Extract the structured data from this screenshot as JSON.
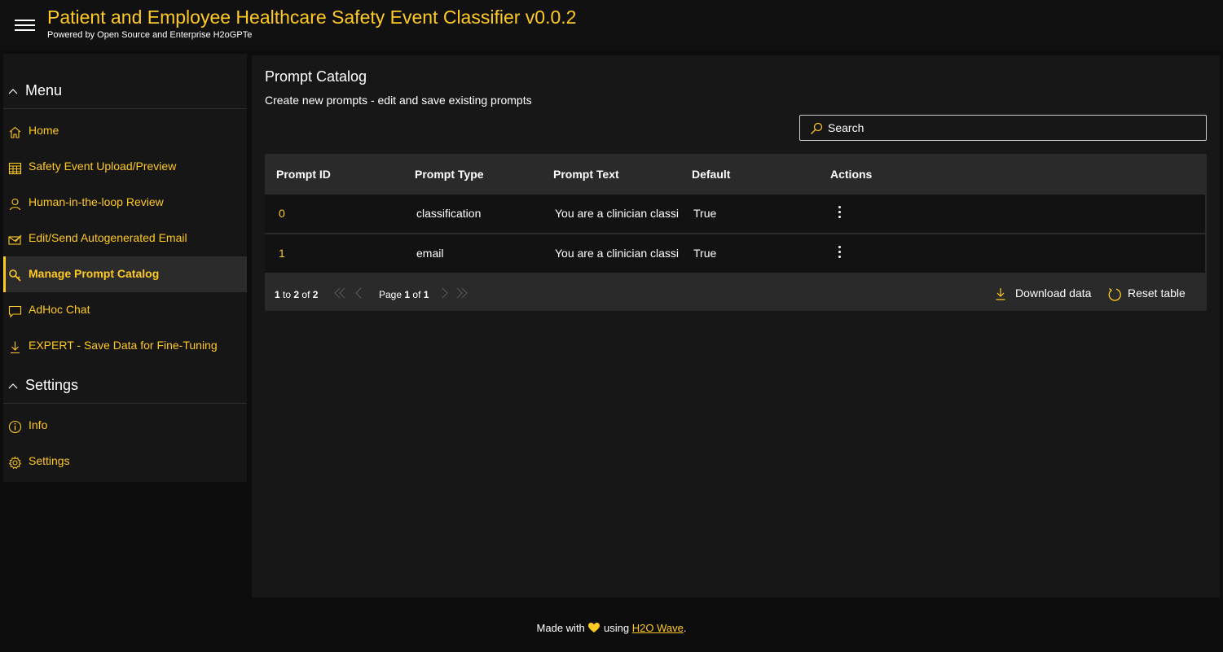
{
  "header": {
    "title": "Patient and Employee Healthcare Safety Event Classifier v0.0.2",
    "subtitle": "Powered by Open Source and Enterprise H2oGPTe"
  },
  "sidebar": {
    "menu_section": "Menu",
    "settings_section": "Settings",
    "items": [
      {
        "label": "Home",
        "icon": "home-icon"
      },
      {
        "label": "Safety Event Upload/Preview",
        "icon": "table-icon"
      },
      {
        "label": "Human-in-the-loop Review",
        "icon": "person-icon"
      },
      {
        "label": "Edit/Send Autogenerated Email",
        "icon": "email-edit-icon"
      },
      {
        "label": "Manage Prompt Catalog",
        "icon": "search-key-icon",
        "active": true
      },
      {
        "label": "AdHoc Chat",
        "icon": "chat-icon"
      },
      {
        "label": "EXPERT - Save Data for Fine-Tuning",
        "icon": "download-icon"
      }
    ],
    "settings_items": [
      {
        "label": "Info",
        "icon": "info-icon"
      },
      {
        "label": "Settings",
        "icon": "gear-icon"
      }
    ]
  },
  "main": {
    "title": "Prompt Catalog",
    "subtitle": "Create new prompts - edit and save existing prompts",
    "search": {
      "placeholder": "Search",
      "value": ""
    },
    "table": {
      "columns": [
        "Prompt ID",
        "Prompt Type",
        "Prompt Text",
        "Default",
        "Actions"
      ],
      "rows": [
        {
          "id": "0",
          "type": "classification",
          "text": "You are a clinician classi",
          "default": "True"
        },
        {
          "id": "1",
          "type": "email",
          "text": "You are a clinician classi",
          "default": "True"
        }
      ],
      "pagination": {
        "range_start": "1",
        "to": "to",
        "range_end": "2",
        "of": "of",
        "total": "2",
        "page_label": "Page",
        "page": "1",
        "page_of": "of",
        "page_total": "1"
      },
      "download_label": "Download data",
      "reset_label": "Reset table"
    }
  },
  "footer": {
    "made_with": "Made with",
    "using": "using",
    "link": "H2O Wave",
    "end": "."
  },
  "colors": {
    "accent": "#fec925",
    "background": "#0d0d0d",
    "card": "#171717",
    "table_header": "#2a2a2a"
  }
}
